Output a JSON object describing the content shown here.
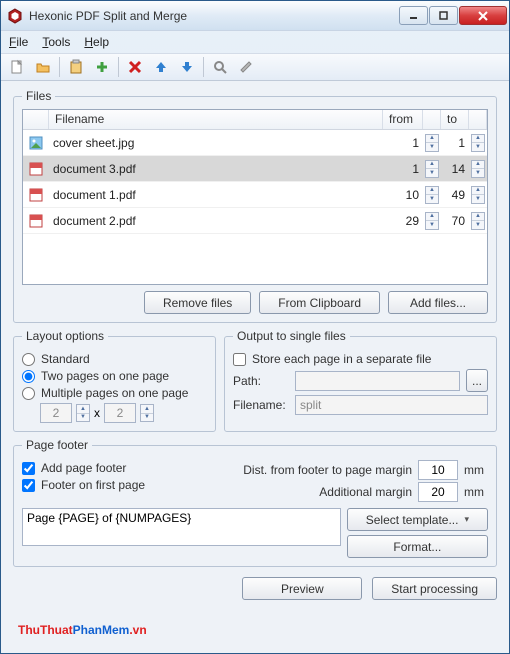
{
  "window": {
    "title": "Hexonic PDF Split and Merge"
  },
  "menu": {
    "file": "File",
    "tools": "Tools",
    "help": "Help"
  },
  "toolbar": {
    "icons": [
      "new-doc-icon",
      "open-folder-icon",
      "paste-clipboard-icon",
      "add-plus-icon",
      "delete-x-icon",
      "arrow-up-icon",
      "arrow-down-icon",
      "zoom-icon",
      "settings-icon"
    ]
  },
  "files": {
    "legend": "Files",
    "headers": {
      "filename": "Filename",
      "from": "from",
      "to": "to"
    },
    "rows": [
      {
        "name": "cover sheet.jpg",
        "from": "1",
        "to": "1",
        "type": "image",
        "selected": false
      },
      {
        "name": "document 3.pdf",
        "from": "1",
        "to": "14",
        "type": "pdf",
        "selected": true
      },
      {
        "name": "document 1.pdf",
        "from": "10",
        "to": "49",
        "type": "pdf",
        "selected": false
      },
      {
        "name": "document 2.pdf",
        "from": "29",
        "to": "70",
        "type": "pdf",
        "selected": false
      }
    ],
    "remove": "Remove files",
    "clipboard": "From Clipboard",
    "add": "Add files..."
  },
  "layout": {
    "legend": "Layout options",
    "standard": "Standard",
    "two": "Two pages on one page",
    "multi": "Multiple pages on one page",
    "w": "2",
    "h": "2",
    "x": "x",
    "selected": "two"
  },
  "output": {
    "legend": "Output to single files",
    "store": "Store each page in a separate file",
    "pathLabel": "Path:",
    "path": "",
    "browse": "...",
    "filenameLabel": "Filename:",
    "filename": "split"
  },
  "footer": {
    "legend": "Page footer",
    "addFooter": "Add page footer",
    "firstPage": "Footer on first page",
    "distLabel": "Dist. from footer to page margin",
    "distValue": "10",
    "addLabel": "Additional margin",
    "addValue": "20",
    "unit": "mm",
    "template": "Page {PAGE} of {NUMPAGES}",
    "selectTpl": "Select template...",
    "format": "Format..."
  },
  "actions": {
    "preview": "Preview",
    "start": "Start processing"
  },
  "watermark": {
    "a": "ThuThuat",
    "b": "PhanMem",
    "c": ".vn"
  }
}
